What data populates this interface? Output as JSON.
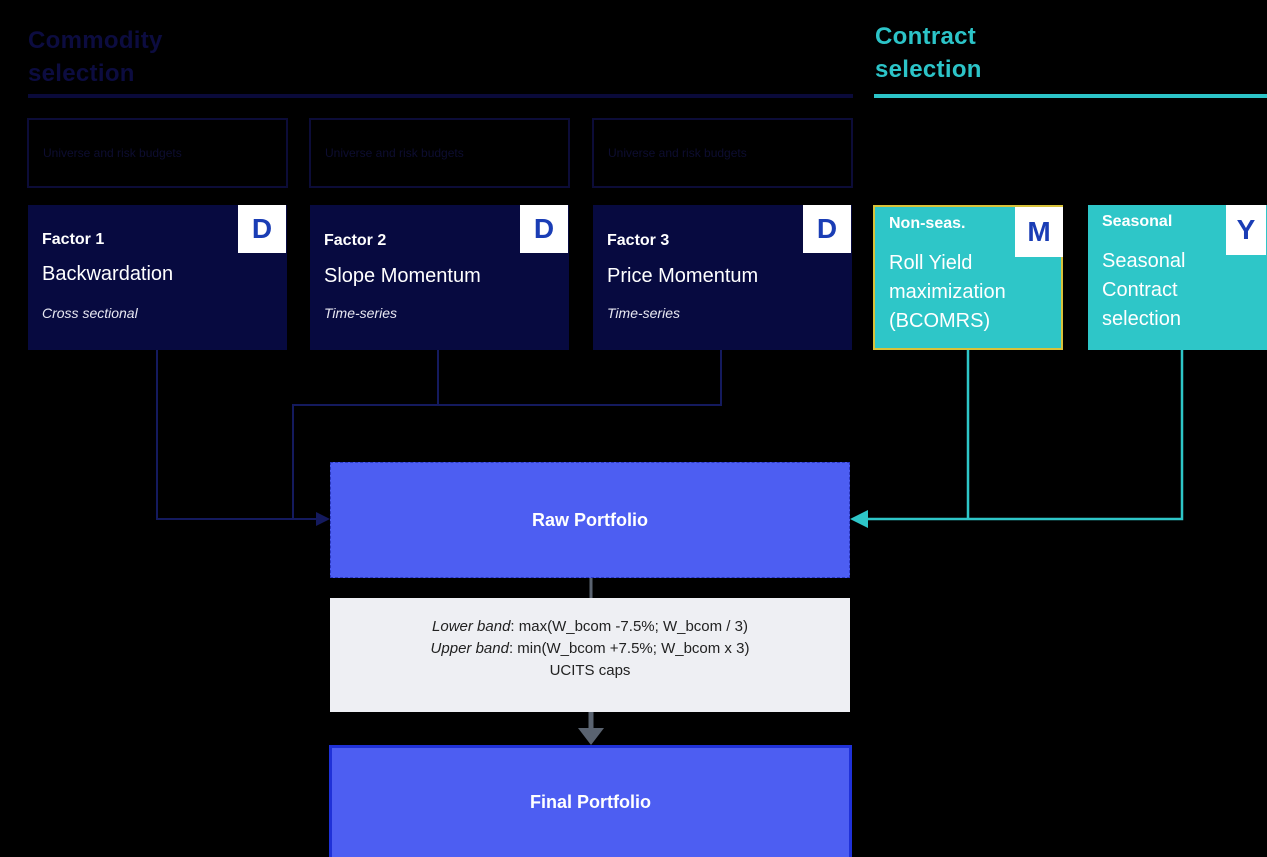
{
  "headers": {
    "commodity": "Commodity selection",
    "contract": "Contract selection"
  },
  "ghost_boxes": [
    {
      "label": "Universe and risk budgets"
    },
    {
      "label": "Universe and risk budgets"
    },
    {
      "label": "Universe and risk budgets"
    }
  ],
  "factors": [
    {
      "title": "Factor 1",
      "name": "Backwardation",
      "type": "Cross sectional",
      "freq": "D"
    },
    {
      "title": "Factor 2",
      "name": "Slope Momentum",
      "type": "Time-series",
      "freq": "D"
    },
    {
      "title": "Factor 3",
      "name": "Price Momentum",
      "type": "Time-series",
      "freq": "D"
    }
  ],
  "contracts": [
    {
      "title": "Non-seas.",
      "name": "Roll Yield maximization (BCOMRS)",
      "freq": "M"
    },
    {
      "title": "Seasonal",
      "name": "Seasonal Contract selection",
      "freq": "Y"
    }
  ],
  "raw_portfolio": "Raw Portfolio",
  "bands": {
    "lower_label": "Lower band",
    "lower_formula": ": max(W_bcom -7.5%; W_bcom / 3)",
    "upper_label": "Upper band",
    "upper_formula": ": min(W_bcom +7.5%; W_bcom x 3)",
    "caps": "UCITS caps"
  },
  "final_portfolio": "Final Portfolio",
  "colors": {
    "navy_card": "#070a40",
    "teal": "#2ec6c8",
    "portfolio_blue": "#4d5ef2",
    "badge_text": "#1a3db5",
    "highlight_border": "#d8c23a"
  }
}
